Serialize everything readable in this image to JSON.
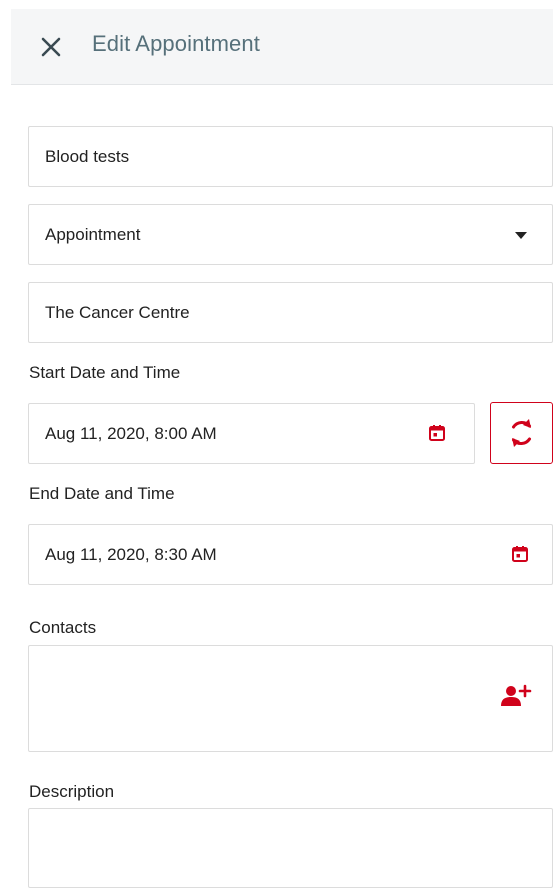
{
  "header": {
    "title": "Edit Appointment",
    "close_icon": "close-icon"
  },
  "form": {
    "title_value": "Blood tests",
    "type_value": "Appointment",
    "location_value": "The Cancer Centre",
    "start_label": "Start Date and Time",
    "start_value": "Aug 11, 2020, 8:00 AM",
    "end_label": "End Date and Time",
    "end_value": "Aug 11, 2020, 8:30 AM",
    "contacts_label": "Contacts",
    "description_label": "Description"
  },
  "icons": {
    "calendar": "calendar-icon",
    "refresh": "refresh-icon",
    "add_contact": "add-person-icon",
    "dropdown": "dropdown-arrow-icon"
  },
  "colors": {
    "accent": "#d0021b",
    "header_bg": "#f5f6f7",
    "header_text": "#56707a",
    "border": "#dcdcdc"
  }
}
